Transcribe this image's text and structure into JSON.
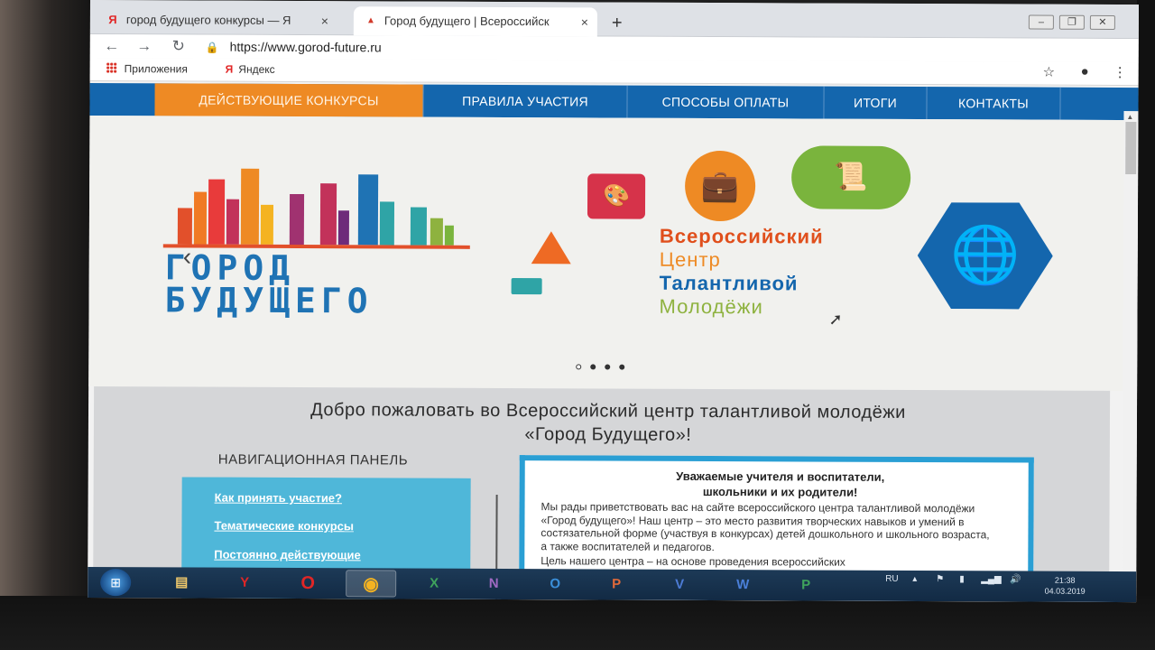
{
  "browser": {
    "tabs": [
      {
        "title": "город будущего конкурсы — Я",
        "favicon": "yandex-icon",
        "active": false
      },
      {
        "title": "Город будущего | Всероссийск",
        "favicon": "city-icon",
        "active": true
      }
    ],
    "new_tab": "+",
    "url": "https://www.gorod-future.ru",
    "bookmarks": [
      {
        "label": "Приложения",
        "icon": "apps-icon"
      },
      {
        "label": "Яндекс",
        "icon": "yandex-icon"
      }
    ]
  },
  "site": {
    "nav": [
      {
        "label": "ДЕЙСТВУЮЩИЕ КОНКУРСЫ",
        "active": true
      },
      {
        "label": "ПРАВИЛА УЧАСТИЯ",
        "active": false
      },
      {
        "label": "СПОСОБЫ ОПЛАТЫ",
        "active": false
      },
      {
        "label": "ИТОГИ",
        "active": false
      },
      {
        "label": "КОНТАКТЫ",
        "active": false
      }
    ],
    "hero": {
      "logo_line1": "ГОРОД",
      "logo_line2": "БУДУЩЕГО",
      "vctm": [
        "Всероссийский",
        "Центр",
        "Талантливой",
        "Молодёжи"
      ],
      "slides": 4,
      "active_slide": 0
    },
    "welcome_title_line1": "Добро пожаловать во Всероссийский центр талантливой молодёжи",
    "welcome_title_line2": "«Город Будущего»!",
    "nav_panel_title": "НАВИГАЦИОННАЯ ПАНЕЛЬ",
    "nav_panel_links": [
      "Как принять участие?",
      "Тематические конкурсы",
      "Постоянно действующие"
    ],
    "greeting_heading_line1": "Уважаемые учителя и воспитатели,",
    "greeting_heading_line2": "школьники и их родители!",
    "greeting_text": "Мы рады приветствовать вас на сайте всероссийского центра талантливой молодёжи «Город будущего»!  Наш центр – это место развития творческих навыков и умений в состязательной форме (участвуя в конкурсах) детей дошкольного и школьного возраста, а также воспитателей и педагогов.",
    "greeting_text_cut": "Цель нашего центра – на основе проведения всероссийских"
  },
  "taskbar": {
    "apps": [
      "explorer-icon",
      "yandex-browser-icon",
      "opera-icon",
      "chrome-icon",
      "excel-icon",
      "onenote-icon",
      "outlook-icon",
      "powerpoint-icon",
      "visio-icon",
      "word-icon",
      "project-icon"
    ],
    "active_app": "chrome-icon",
    "language": "RU",
    "time": "21:38",
    "date": "04.03.2019"
  },
  "colors": {
    "nav_blue": "#1466ad",
    "nav_active_orange": "#ee8a24",
    "panel_cyan": "#4fb7d9",
    "box_border": "#2a9fd4"
  }
}
